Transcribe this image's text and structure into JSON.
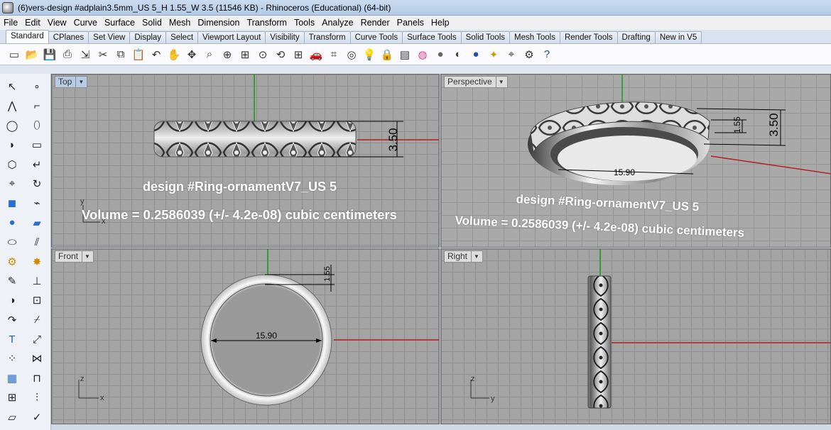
{
  "window": {
    "title": "(6)vers-design #adplain3.5mm_US 5_H 1.55_W 3.5 (11546 KB) - Rhinoceros (Educational) (64-bit)"
  },
  "menu": [
    "File",
    "Edit",
    "View",
    "Curve",
    "Surface",
    "Solid",
    "Mesh",
    "Dimension",
    "Transform",
    "Tools",
    "Analyze",
    "Render",
    "Panels",
    "Help"
  ],
  "tabs": [
    "Standard",
    "CPlanes",
    "Set View",
    "Display",
    "Select",
    "Viewport Layout",
    "Visibility",
    "Transform",
    "Curve Tools",
    "Surface Tools",
    "Solid Tools",
    "Mesh Tools",
    "Render Tools",
    "Drafting",
    "New in V5"
  ],
  "active_tab": "Standard",
  "toolbar_icons": [
    "new-icon",
    "open-icon",
    "save-icon",
    "print-icon",
    "import-icon",
    "cut-icon",
    "copy-icon",
    "paste-icon",
    "undo-icon",
    "pan-icon",
    "move-icon",
    "zoom-icon",
    "zoom-window-icon",
    "zoom-extents-icon",
    "zoom-selected-icon",
    "rotate-view-icon",
    "four-viewports-icon",
    "car-icon",
    "named-view-icon",
    "cplane-icon",
    "light-icon",
    "lock-icon",
    "layers-icon",
    "color-wheel-icon",
    "material-sphere-icon",
    "render-sphere-icon",
    "blue-sphere-icon",
    "lights-icon",
    "grid-snap-icon",
    "options-icon",
    "help-icon"
  ],
  "sidebar_icons_left": [
    "select-arrow-icon",
    "polyline-icon",
    "circle-icon",
    "arc-icon",
    "polygon-icon",
    "control-point-icon",
    "box-icon",
    "sphere-icon",
    "cylinder-icon",
    "gear-icon",
    "line-edit-icon",
    "boolean-icon",
    "curve-icon",
    "text-icon",
    "array-icon",
    "mesh-icon",
    "grid-icon",
    "paint-icon",
    "cone-icon"
  ],
  "sidebar_icons_right": [
    "point-icon",
    "rebuild-icon",
    "ellipse-icon",
    "rectangle-icon",
    "fillet-icon",
    "revolve-icon",
    "sweep-icon",
    "surface-icon",
    "split-icon",
    "explode-icon",
    "flatten-icon",
    "group-icon",
    "trim-icon",
    "scale-icon",
    "join-icon",
    "dimension-icon",
    "distribute-icon",
    "checkmark-icon",
    "drape-icon"
  ],
  "viewports": {
    "top": {
      "label": "Top",
      "dimension_height": "3.50",
      "caption_design": "design #Ring-ornamentV7_US 5",
      "caption_volume": "Volume = 0.2586039 (+/- 4.2e-08) cubic centimeters",
      "axis_x": "x",
      "axis_y": "y"
    },
    "perspective": {
      "label": "Perspective",
      "dimension_height": "3.50",
      "dimension_thickness": "1.55",
      "dimension_diameter": "15.90",
      "caption_design": "design #Ring-ornamentV7_US 5",
      "caption_volume": "Volume = 0.2586039 (+/- 4.2e-08) cubic centimeters"
    },
    "front": {
      "label": "Front",
      "dimension_diameter": "15.90",
      "dimension_thickness": "1.55",
      "axis_x": "x",
      "axis_z": "z"
    },
    "right": {
      "label": "Right",
      "axis_y": "y",
      "axis_z": "z"
    }
  },
  "colors": {
    "x_axis": "#b02020",
    "y_axis": "#1a9a1a",
    "viewport_bg": "#a4a4a4",
    "caption": "#ffffff"
  }
}
